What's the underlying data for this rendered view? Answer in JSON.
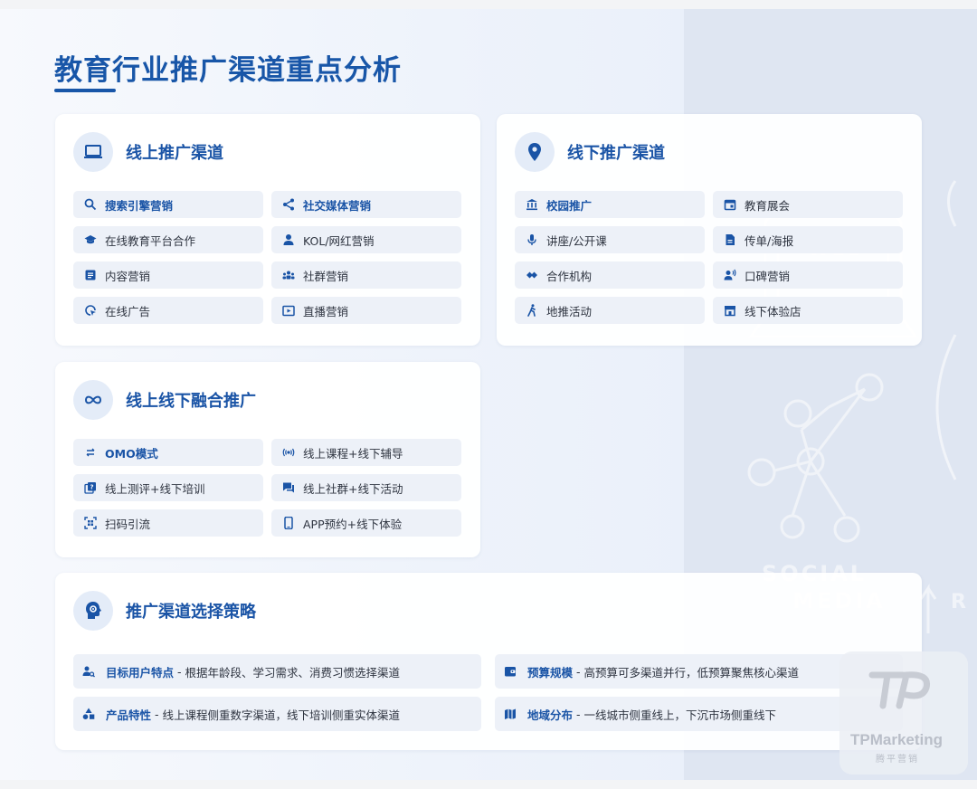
{
  "title": "教育行业推广渠道重点分析",
  "online": {
    "title": "线上推广渠道",
    "items": [
      {
        "label": "搜索引擎营销",
        "icon": "search-icon",
        "highlight": true
      },
      {
        "label": "社交媒体营销",
        "icon": "share-icon",
        "highlight": true
      },
      {
        "label": "在线教育平台合作",
        "icon": "graduation-cap-icon",
        "highlight": false
      },
      {
        "label": "KOL/网红营销",
        "icon": "person-icon",
        "highlight": false
      },
      {
        "label": "内容营销",
        "icon": "article-icon",
        "highlight": false
      },
      {
        "label": "社群营销",
        "icon": "group-icon",
        "highlight": false
      },
      {
        "label": "在线广告",
        "icon": "ad-click-icon",
        "highlight": false
      },
      {
        "label": "直播营销",
        "icon": "live-play-icon",
        "highlight": false
      }
    ]
  },
  "offline": {
    "title": "线下推广渠道",
    "items": [
      {
        "label": "校园推广",
        "icon": "institution-icon",
        "highlight": true
      },
      {
        "label": "教育展会",
        "icon": "event-calendar-icon",
        "highlight": false
      },
      {
        "label": "讲座/公开课",
        "icon": "microphone-icon",
        "highlight": false
      },
      {
        "label": "传单/海报",
        "icon": "document-icon",
        "highlight": false
      },
      {
        "label": "合作机构",
        "icon": "handshake-icon",
        "highlight": false
      },
      {
        "label": "口碑营销",
        "icon": "speaking-person-icon",
        "highlight": false
      },
      {
        "label": "地推活动",
        "icon": "walking-icon",
        "highlight": false
      },
      {
        "label": "线下体验店",
        "icon": "store-icon",
        "highlight": false
      }
    ]
  },
  "omo": {
    "title": "线上线下融合推广",
    "items": [
      {
        "label": "OMO模式",
        "icon": "swap-arrows-icon",
        "highlight": true
      },
      {
        "label": "线上课程+线下辅导",
        "icon": "broadcast-icon",
        "highlight": false
      },
      {
        "label": "线上测评+线下培训",
        "icon": "quiz-icon",
        "highlight": false
      },
      {
        "label": "线上社群+线下活动",
        "icon": "chat-bubbles-icon",
        "highlight": false
      },
      {
        "label": "扫码引流",
        "icon": "qr-scan-icon",
        "highlight": false
      },
      {
        "label": "APP预约+线下体验",
        "icon": "smartphone-icon",
        "highlight": false
      }
    ]
  },
  "strategy": {
    "title": "推广渠道选择策略",
    "items": [
      {
        "key": "目标用户特点",
        "sep": "-",
        "desc": "根据年龄段、学习需求、消费习惯选择渠道",
        "icon": "user-search-icon"
      },
      {
        "key": "预算规模",
        "sep": "-",
        "desc": "高预算可多渠道并行，低预算聚焦核心渠道",
        "icon": "wallet-icon"
      },
      {
        "key": "产品特性",
        "sep": "-",
        "desc": "线上课程侧重数字渠道，线下培训侧重实体渠道",
        "icon": "category-icon"
      },
      {
        "key": "地域分布",
        "sep": "-",
        "desc": "一线城市侧重线上，下沉市场侧重线下",
        "icon": "map-icon"
      }
    ]
  },
  "watermark": {
    "brand": "TPMarketing",
    "cn": "腾平营销"
  },
  "colors": {
    "accent": "#1a54a6",
    "item_bg": "#edf1f8",
    "icon_bg": "#e4ecf8"
  }
}
